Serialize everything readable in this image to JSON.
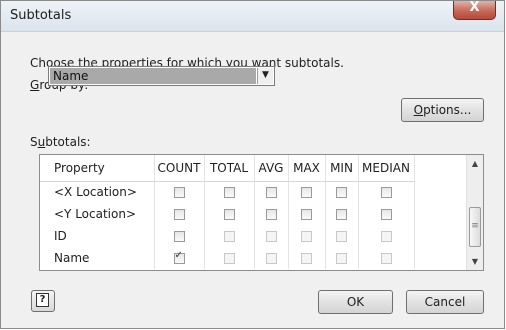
{
  "window": {
    "title": "Subtotals",
    "close_glyph": "X"
  },
  "instructions": "Choose the properties for which you want subtotals.",
  "group_by": {
    "label_mnemonic": "G",
    "label_rest": "roup by:",
    "selected": "Name",
    "arrow": "▼"
  },
  "buttons": {
    "options_mnemonic": "O",
    "options_rest": "ptions...",
    "ok": "OK",
    "cancel": "Cancel",
    "help": "?"
  },
  "subtotals": {
    "label_pre": "S",
    "label_mnemonic": "u",
    "label_rest": "btotals:",
    "columns": [
      "Property",
      "COUNT",
      "TOTAL",
      "AVG",
      "MAX",
      "MIN",
      "MEDIAN"
    ],
    "rows": [
      {
        "property": "<X Location>",
        "checks": [
          false,
          false,
          false,
          false,
          false,
          false
        ],
        "enabled": [
          true,
          true,
          true,
          true,
          true,
          true
        ]
      },
      {
        "property": "<Y Location>",
        "checks": [
          false,
          false,
          false,
          false,
          false,
          false
        ],
        "enabled": [
          true,
          true,
          true,
          true,
          true,
          true
        ]
      },
      {
        "property": "ID",
        "checks": [
          false,
          false,
          false,
          false,
          false,
          false
        ],
        "enabled": [
          true,
          false,
          false,
          false,
          false,
          false
        ]
      },
      {
        "property": "Name",
        "checks": [
          true,
          false,
          false,
          false,
          false,
          false
        ],
        "enabled": [
          true,
          false,
          false,
          false,
          false,
          false
        ]
      }
    ],
    "scrollbar": {
      "up": "▲",
      "down": "▼",
      "grip": "≡"
    }
  }
}
